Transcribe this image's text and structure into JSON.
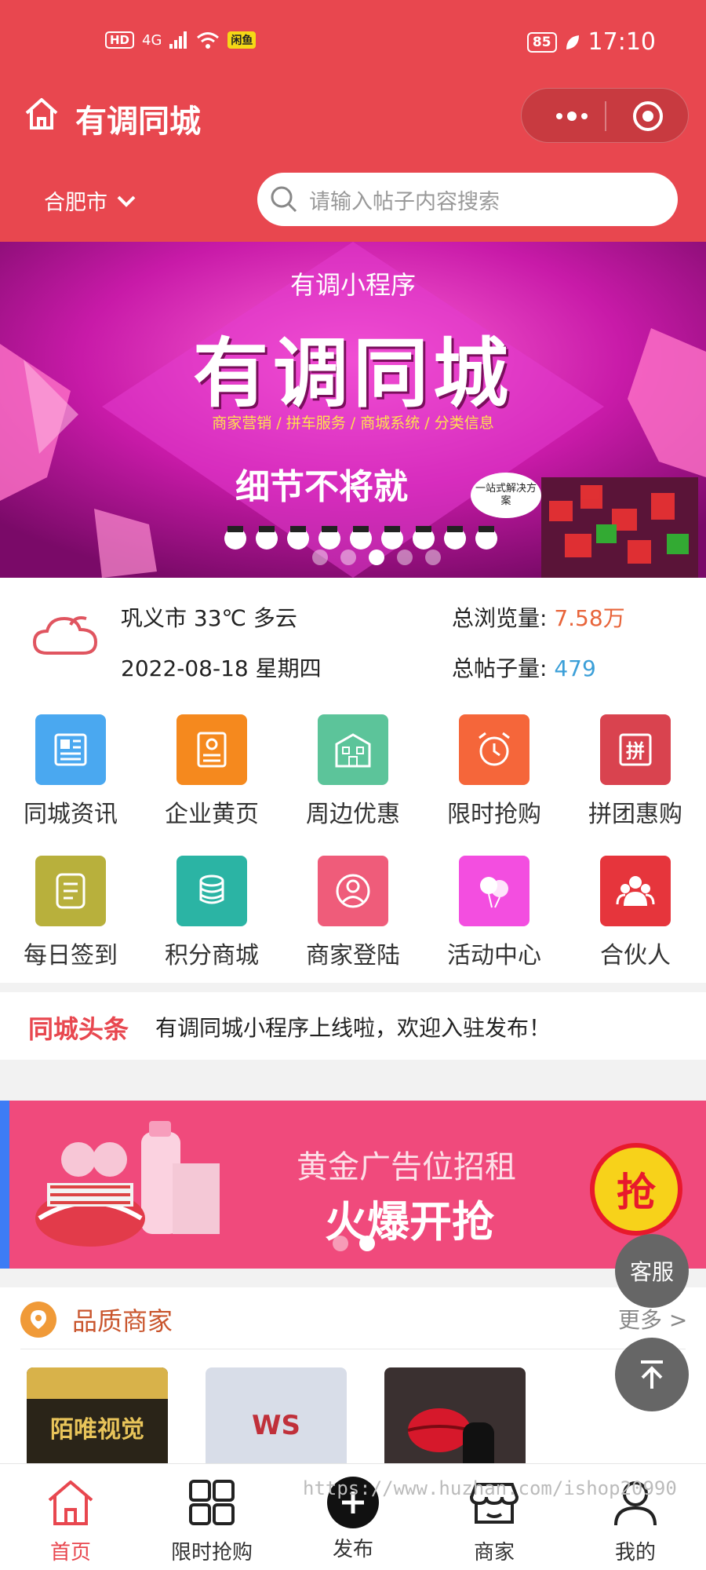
{
  "status_bar": {
    "left_labels": [
      "HD",
      "4G",
      "闲鱼"
    ],
    "battery": "85",
    "time": "17:10"
  },
  "header": {
    "title": "有调同城",
    "city": "合肥市",
    "search_placeholder": "请输入帖子内容搜索"
  },
  "banner": {
    "subtitle": "有调小程序",
    "title": "有调同城",
    "services": "商家营销 / 拼车服务 / 商城系统 / 分类信息",
    "slogan": "细节不将就",
    "bubble": "一站式解决方案",
    "dots": 5,
    "active_dot": 3
  },
  "info": {
    "weather": "巩义市 33℃ 多云",
    "date": "2022-08-18 星期四",
    "views_label": "总浏览量:",
    "views_value": "7.58万",
    "posts_label": "总帖子量:",
    "posts_value": "479"
  },
  "grid": [
    {
      "label": "同城资讯",
      "color": "#4aa8f0",
      "icon": "newspaper-icon"
    },
    {
      "label": "企业黄页",
      "color": "#f5891e",
      "icon": "id-card-icon"
    },
    {
      "label": "周边优惠",
      "color": "#5cc49a",
      "icon": "building-icon"
    },
    {
      "label": "限时抢购",
      "color": "#f5663a",
      "icon": "alarm-clock-icon"
    },
    {
      "label": "拼团惠购",
      "color": "#d9434f",
      "icon": "group-buy-icon"
    },
    {
      "label": "每日签到",
      "color": "#b8b03c",
      "icon": "checklist-icon"
    },
    {
      "label": "积分商城",
      "color": "#2bb4a4",
      "icon": "coins-icon"
    },
    {
      "label": "商家登陆",
      "color": "#ef5c7a",
      "icon": "user-circle-icon"
    },
    {
      "label": "活动中心",
      "color": "#f34ee0",
      "icon": "balloons-icon"
    },
    {
      "label": "合伙人",
      "color": "#e6353c",
      "icon": "partners-icon"
    }
  ],
  "news": {
    "tag": "同城头条",
    "text": "有调同城小程序上线啦，欢迎入驻发布！"
  },
  "ad": {
    "line1": "黄金广告位招租",
    "line2": "火爆开抢",
    "badge": "抢",
    "dots": 2,
    "active_dot": 2
  },
  "merchants": {
    "title": "品质商家",
    "more": "更多 >",
    "cards": [
      "陌唯视觉",
      "WS",
      ""
    ]
  },
  "floating": {
    "service": "客服"
  },
  "tabbar": [
    {
      "label": "首页",
      "icon": "home-icon",
      "active": true
    },
    {
      "label": "限时抢购",
      "icon": "grid-icon",
      "active": false
    },
    {
      "label": "发布",
      "icon": "plus-icon",
      "active": false
    },
    {
      "label": "商家",
      "icon": "store-icon",
      "active": false
    },
    {
      "label": "我的",
      "icon": "user-icon",
      "active": false
    }
  ],
  "watermark": "https://www.huzhan.com/ishop20990"
}
